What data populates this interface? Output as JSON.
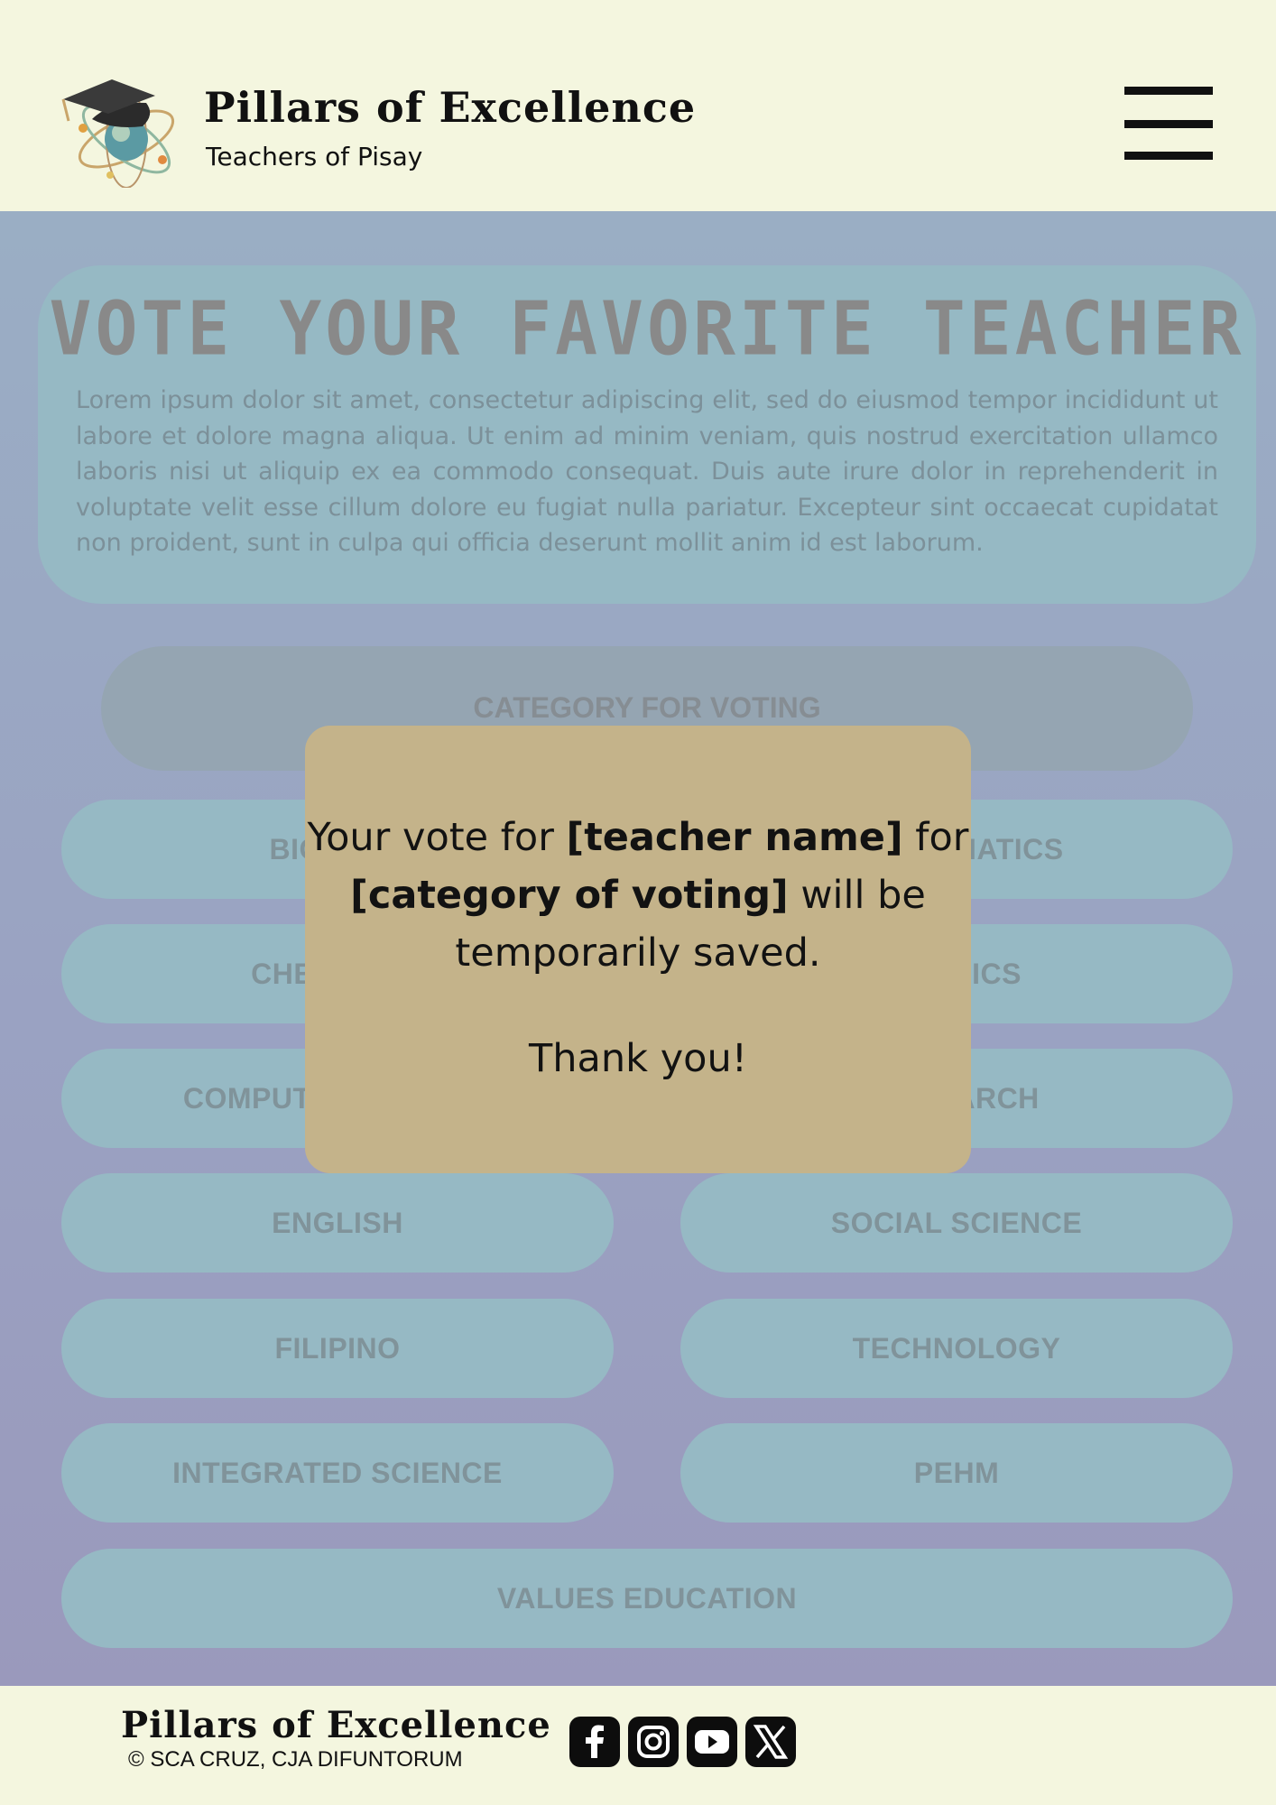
{
  "header": {
    "brand_title": "Pillars of Excellence",
    "brand_subtitle": "Teachers of Pisay",
    "logo_icon": "graduation-cap-atom-icon",
    "menu_icon": "hamburger-menu-icon"
  },
  "intro": {
    "title": "VOTE YOUR FAVORITE TEACHER",
    "body": "Lorem ipsum dolor sit amet, consectetur adipiscing elit, sed do eiusmod tempor incididunt ut labore et dolore magna aliqua. Ut enim ad minim veniam, quis nostrud exercitation ullamco laboris nisi ut aliquip ex ea commodo consequat. Duis aute irure dolor in reprehenderit in voluptate velit esse cillum dolore eu fugiat nulla pariatur. Excepteur sint occaecat cupidatat non proident, sunt in culpa qui officia deserunt mollit anim id est laborum."
  },
  "category_header": "CATEGORY FOR VOTING",
  "subjects": {
    "biology": "BIOLOGY",
    "mathematics": "MATHEMATICS",
    "chemistry": "CHEMISTRY",
    "physics": "PHYSICS",
    "computer_science": "COMPUTER SCIENCE",
    "research": "RESEARCH",
    "english": "ENGLISH",
    "social_science": "SOCIAL SCIENCE",
    "filipino": "FILIPINO",
    "technology": "TECHNOLOGY",
    "integrated_science": "INTEGRATED SCIENCE",
    "pehm": "PEHM",
    "values_education": "VALUES EDUCATION"
  },
  "modal": {
    "prefix": "Your vote for ",
    "teacher": "[teacher name]",
    "mid": " for",
    "category": "[category of voting]",
    "suffix": " will be",
    "line3": "temporarily saved.",
    "thanks": "Thank you!"
  },
  "footer": {
    "title": "Pillars of Excellence",
    "copyright": "© SCA CRUZ, CJA DIFUNTORUM",
    "social_icons": [
      "facebook-icon",
      "instagram-icon",
      "youtube-icon",
      "x-icon"
    ]
  },
  "colors": {
    "background": "#f4f6df",
    "card": "#96b9c4",
    "modal": "#c4b38a",
    "text_dark": "#111111"
  }
}
